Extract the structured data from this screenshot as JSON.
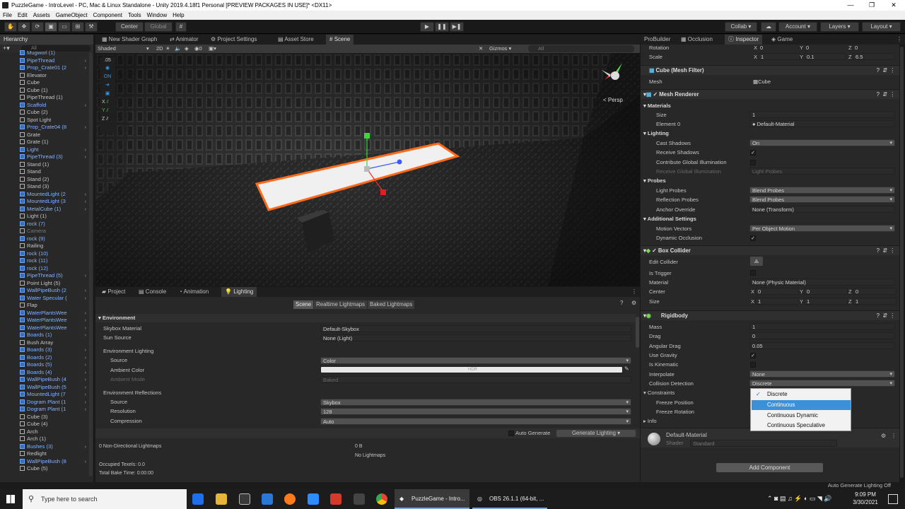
{
  "window": {
    "title": "PuzzleGame - IntroLevel - PC, Mac & Linux Standalone - Unity 2019.4.18f1 Personal [PREVIEW PACKAGES IN USE]* <DX11>"
  },
  "menu": [
    "File",
    "Edit",
    "Assets",
    "GameObject",
    "Component",
    "Tools",
    "Window",
    "Help"
  ],
  "toolbar": {
    "center": "Center",
    "global": "Global",
    "collab": "Collab ▾",
    "account": "Account",
    "layers": "Layers",
    "layout": "Layout"
  },
  "hierarchy": {
    "tab": "Hierarchy",
    "search": "All",
    "items": [
      {
        "t": "Mugworl (1)",
        "k": "p"
      },
      {
        "t": "PipeThread",
        "k": "p",
        "a": 1
      },
      {
        "t": "Prop_Crate01 (2",
        "k": "p",
        "a": 1
      },
      {
        "t": "Elevator",
        "k": "n"
      },
      {
        "t": "Cube",
        "k": "n"
      },
      {
        "t": "Cube (1)",
        "k": "n"
      },
      {
        "t": "PipeThread (1)",
        "k": "n"
      },
      {
        "t": "Scaffold",
        "k": "p",
        "a": 1
      },
      {
        "t": "Cube (2)",
        "k": "n"
      },
      {
        "t": "Spot Light",
        "k": "n"
      },
      {
        "t": "Prop_Crate04 (8",
        "k": "p",
        "a": 1
      },
      {
        "t": "Grate",
        "k": "n"
      },
      {
        "t": "Grate (1)",
        "k": "n"
      },
      {
        "t": "Light",
        "k": "p",
        "a": 1
      },
      {
        "t": "PipeThread (3)",
        "k": "p",
        "a": 1
      },
      {
        "t": "Stand (1)",
        "k": "n"
      },
      {
        "t": "Stand",
        "k": "n"
      },
      {
        "t": "Stand (2)",
        "k": "n"
      },
      {
        "t": "Stand (3)",
        "k": "n"
      },
      {
        "t": "MountedLight (2",
        "k": "p",
        "a": 1
      },
      {
        "t": "MountedLight (3",
        "k": "p",
        "a": 1
      },
      {
        "t": "MetalCube (1)",
        "k": "p",
        "a": 1
      },
      {
        "t": "Light (1)",
        "k": "n"
      },
      {
        "t": "rock (7)",
        "k": "p"
      },
      {
        "t": "Camera",
        "k": "g"
      },
      {
        "t": "rock (9)",
        "k": "p"
      },
      {
        "t": "Railing",
        "k": "n"
      },
      {
        "t": "rock (10)",
        "k": "p"
      },
      {
        "t": "rock (11)",
        "k": "p"
      },
      {
        "t": "rock (12)",
        "k": "p"
      },
      {
        "t": "PipeThread (5)",
        "k": "p",
        "a": 1
      },
      {
        "t": "Point Light (5)",
        "k": "n"
      },
      {
        "t": "WallPipeBush (2",
        "k": "p",
        "a": 1
      },
      {
        "t": "Water Specular (",
        "k": "p",
        "a": 1
      },
      {
        "t": "Flap",
        "k": "n"
      },
      {
        "t": "WaterPlantsWee",
        "k": "p",
        "a": 1
      },
      {
        "t": "WaterPlantsWee",
        "k": "p",
        "a": 1
      },
      {
        "t": "WaterPlantsWee",
        "k": "p",
        "a": 1
      },
      {
        "t": "Boards (1)",
        "k": "p",
        "a": 1
      },
      {
        "t": "Bush Array",
        "k": "n"
      },
      {
        "t": "Boards (3)",
        "k": "p",
        "a": 1
      },
      {
        "t": "Boards (2)",
        "k": "p",
        "a": 1
      },
      {
        "t": "Boards (5)",
        "k": "p",
        "a": 1
      },
      {
        "t": "Boards (4)",
        "k": "p",
        "a": 1
      },
      {
        "t": "WallPipeBush (4",
        "k": "p",
        "a": 1
      },
      {
        "t": "WallPipeBush (5",
        "k": "p",
        "a": 1
      },
      {
        "t": "MountedLight (7",
        "k": "p",
        "a": 1
      },
      {
        "t": "Dogram Plant (1",
        "k": "p",
        "a": 1
      },
      {
        "t": "Dogram Plant (1",
        "k": "p",
        "a": 1
      },
      {
        "t": "Cube (3)",
        "k": "n"
      },
      {
        "t": "Cube (4)",
        "k": "n"
      },
      {
        "t": "Arch",
        "k": "n"
      },
      {
        "t": "Arch (1)",
        "k": "n"
      },
      {
        "t": "Bushes (3)",
        "k": "p",
        "a": 1
      },
      {
        "t": "Redlight",
        "k": "n"
      },
      {
        "t": "WallPipeBush (8",
        "k": "p",
        "a": 1
      },
      {
        "t": "Cube (5)",
        "k": "n"
      }
    ]
  },
  "scene": {
    "tabs": [
      "New Shader Graph",
      "Animator",
      "Project Settings",
      "Asset Store",
      "Scene"
    ],
    "shading": "Shaded",
    "mode2d": "2D",
    "gizmos": "Gizmos",
    "search": "All",
    "persp": "< Persp",
    "snap": ".05"
  },
  "bottom": {
    "tabs": [
      "Project",
      "Console",
      "Animation",
      "Lighting"
    ],
    "subtabs": [
      "Scene",
      "Realtime Lightmaps",
      "Baked Lightmaps"
    ],
    "environment": "Environment",
    "skybox_label": "Skybox Material",
    "skybox_value": "Default-Skybox",
    "sun_label": "Sun Source",
    "sun_value": "None (Light)",
    "env_lighting": "Environment Lighting",
    "source_label": "Source",
    "source_value": "Color",
    "ambient_label": "Ambient Color",
    "hdr": "HDR",
    "ambient_mode_label": "Ambient Mode",
    "ambient_mode_value": "Baked",
    "env_refl": "Environment Reflections",
    "refl_source_label": "Source",
    "refl_source_value": "Skybox",
    "resolution_label": "Resolution",
    "resolution_value": "128",
    "compression_label": "Compression",
    "compression_value": "Auto",
    "auto_generate": "Auto Generate",
    "generate": "Generate Lighting",
    "nondir": "0 Non-Directional Lightmaps",
    "size": "0 B",
    "no_lightmaps": "No Lightmaps",
    "occupied": "Occupied Texels: 0.0",
    "bake_time": "Total Bake Time: 0:00:00"
  },
  "inspector": {
    "tabs": [
      "ProBuilder",
      "Occlusion",
      "Inspector",
      "Game"
    ],
    "rotation": {
      "label": "Rotation",
      "x": "0",
      "y": "0",
      "z": "0"
    },
    "scale": {
      "label": "Scale",
      "x": "1",
      "y": "0.1",
      "z": "6.5"
    },
    "mesh_filter": "Cube (Mesh Filter)",
    "mesh_label": "Mesh",
    "mesh_value": "Cube",
    "mesh_renderer": "Mesh Renderer",
    "materials": "Materials",
    "size_label": "Size",
    "size_value": "1",
    "element_label": "Element 0",
    "element_value": "Default-Material",
    "lighting": "Lighting",
    "cast_label": "Cast Shadows",
    "cast_value": "On",
    "receive_label": "Receive Shadows",
    "contrib_label": "Contribute Global Illumination",
    "recv_gi_label": "Receive Global Illumination",
    "recv_gi_value": "Light Probes",
    "probes": "Probes",
    "lp_label": "Light Probes",
    "lp_value": "Blend Probes",
    "rp_label": "Reflection Probes",
    "rp_value": "Blend Probes",
    "anchor_label": "Anchor Override",
    "anchor_value": "None (Transform)",
    "additional": "Additional Settings",
    "mv_label": "Motion Vectors",
    "mv_value": "Per Object Motion",
    "dyn_label": "Dynamic Occlusion",
    "box_collider": "Box Collider",
    "edit_collider": "Edit Collider",
    "trigger_label": "Is Trigger",
    "material_label": "Material",
    "material_value": "None (Physic Material)",
    "center": {
      "label": "Center",
      "x": "0",
      "y": "0",
      "z": "0"
    },
    "bsize": {
      "label": "Size",
      "x": "1",
      "y": "1",
      "z": "1"
    },
    "rigidbody": "Rigidbody",
    "mass_label": "Mass",
    "mass_value": "1",
    "drag_label": "Drag",
    "drag_value": "0",
    "adrag_label": "Angular Drag",
    "adrag_value": "0.05",
    "grav_label": "Use Gravity",
    "kin_label": "Is Kinematic",
    "interp_label": "Interpolate",
    "interp_value": "None",
    "cd_label": "Collision Detection",
    "cd_value": "Discrete",
    "constraints": "Constraints",
    "fpos": "Freeze Position",
    "frot": "Freeze Rotation",
    "info": "Info",
    "mat_name": "Default-Material",
    "shader_label": "Shader",
    "shader_value": "Standard",
    "add_component": "Add Component",
    "dropdown": [
      "Discrete",
      "Continuous",
      "Continuous Dynamic",
      "Continuous Speculative"
    ]
  },
  "status": "Auto Generate Lighting Off",
  "taskbar": {
    "search": "Type here to search",
    "app1": "PuzzleGame - Intro...",
    "app2": "OBS 26.1.1 (64-bit, ...",
    "time": "9:09 PM",
    "date": "3/30/2021"
  }
}
